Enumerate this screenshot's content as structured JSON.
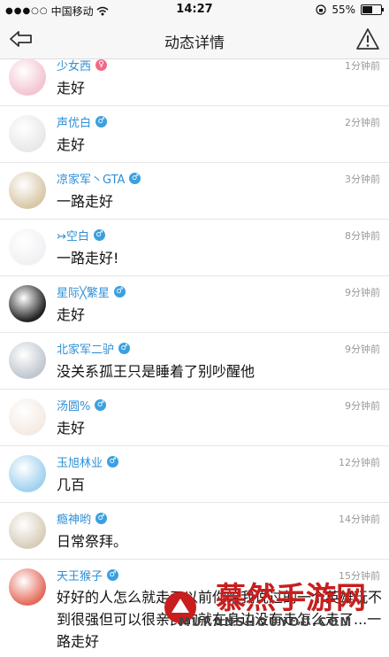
{
  "status_bar": {
    "signal": "●●●○○",
    "carrier": "中国移动",
    "time": "14:27",
    "battery": "55%",
    "battery_level": 0.55
  },
  "nav": {
    "title": "动态详情"
  },
  "comments": [
    {
      "name": "少女西",
      "gender": "f",
      "time": "1分钟前",
      "text": "走好"
    },
    {
      "name": "声优白",
      "gender": "m",
      "time": "2分钟前",
      "text": "走好"
    },
    {
      "name": "凉家军丶GTA",
      "gender": "m",
      "time": "3分钟前",
      "text": "一路走好"
    },
    {
      "name": "↣空白",
      "gender": "m",
      "time": "8分钟前",
      "text": "一路走好!"
    },
    {
      "name": "星际╳繁星",
      "gender": "m",
      "time": "9分钟前",
      "text": "走好"
    },
    {
      "name": "北家军二驴",
      "gender": "m",
      "time": "9分钟前",
      "text": "没关系孤王只是睡着了别吵醒他"
    },
    {
      "name": "汤圆%",
      "gender": "m",
      "time": "9分钟前",
      "text": "走好"
    },
    {
      "name": "玉旭林业",
      "gender": "m",
      "time": "12分钟前",
      "text": "几百"
    },
    {
      "name": "瘾神哟",
      "gender": "m",
      "time": "14分钟前",
      "text": "日常祭拜。"
    },
    {
      "name": "天王猴子",
      "gender": "m",
      "time": "15分钟前",
      "text": "好好的人怎么就走了以前你给我说过的一个英雄玩不到很强但可以很亲民的就在身边没有走怎么走了...一路走好"
    }
  ],
  "watermark": {
    "brand": "慕然手游网",
    "sub": "MURANSHOUYOU.COM"
  },
  "colors": {
    "name": "#2f8fd6",
    "male": "#3aa0e0",
    "female": "#f06a8a"
  }
}
